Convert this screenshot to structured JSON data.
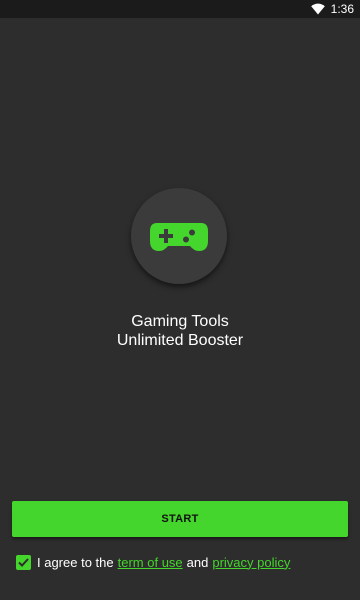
{
  "status_bar": {
    "time": "1:36",
    "wifi_icon": "wifi-icon"
  },
  "app": {
    "logo_icon": "gamepad-icon",
    "title_line1": "Gaming Tools",
    "title_line2": "Unlimited Booster"
  },
  "start_button": {
    "label": "START"
  },
  "agreement": {
    "checked": true,
    "checkbox_icon": "checkmark-icon",
    "prefix": "I agree to the",
    "terms_link": "term of use",
    "conjunction": "and",
    "privacy_link": "privacy policy"
  },
  "colors": {
    "background": "#2d2d2d",
    "status_bar": "#1b1b1b",
    "accent": "#44d62c",
    "logo_circle": "#3b3b3b"
  }
}
